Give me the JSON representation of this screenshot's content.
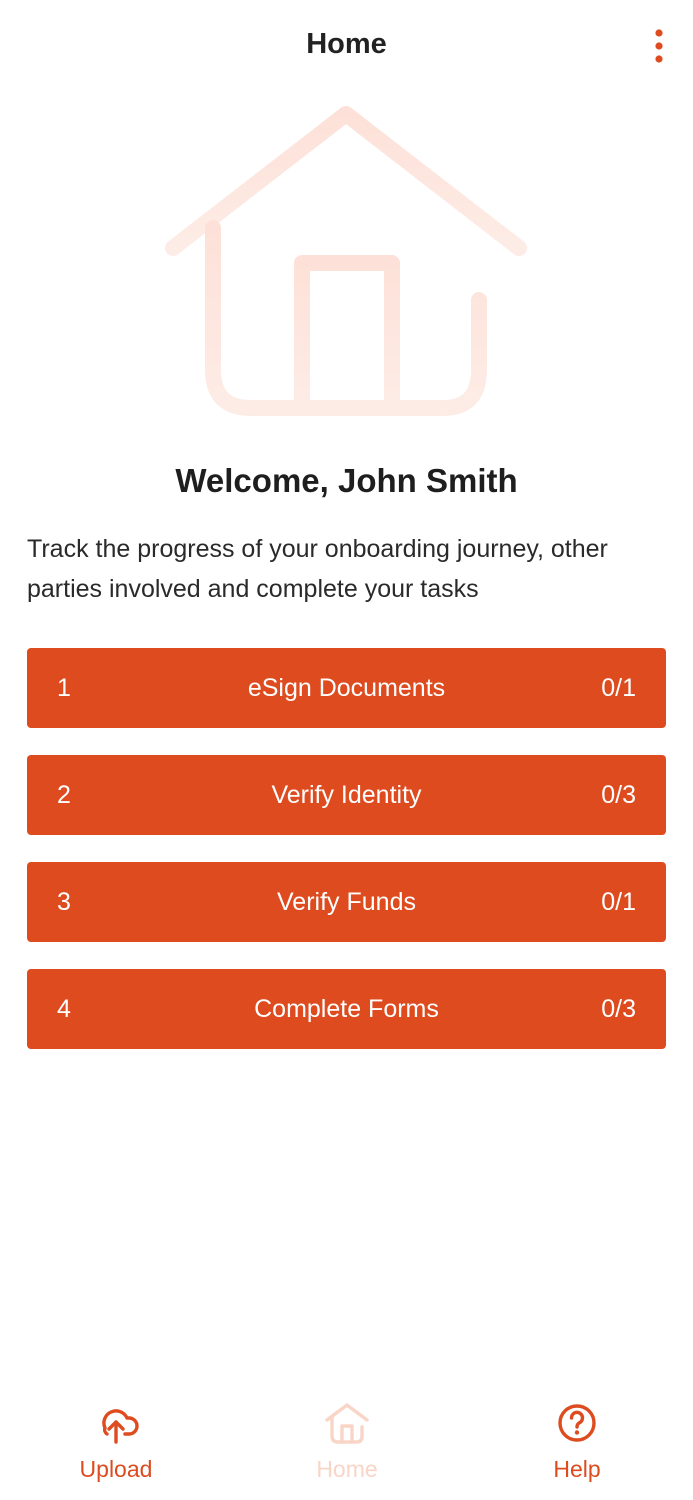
{
  "header": {
    "title": "Home",
    "menu_icon": "more-vertical-icon"
  },
  "hero": {
    "icon": "house-illustration"
  },
  "welcome": {
    "title": "Welcome, John Smith",
    "description": "Track the progress of your onboarding journey, other parties involved and complete your tasks"
  },
  "tasks": [
    {
      "number": "1",
      "label": "eSign Documents",
      "count": "0/1"
    },
    {
      "number": "2",
      "label": "Verify Identity",
      "count": "0/3"
    },
    {
      "number": "3",
      "label": "Verify Funds",
      "count": "0/1"
    },
    {
      "number": "4",
      "label": "Complete Forms",
      "count": "0/3"
    }
  ],
  "bottom_nav": {
    "upload": {
      "label": "Upload",
      "icon": "cloud-upload-icon"
    },
    "home": {
      "label": "Home",
      "icon": "home-icon"
    },
    "help": {
      "label": "Help",
      "icon": "help-circle-icon"
    }
  },
  "colors": {
    "accent": "#dd4b1f",
    "accent_light": "#fde3da",
    "inactive": "#f8d5c7",
    "text": "#1f1f1f"
  }
}
